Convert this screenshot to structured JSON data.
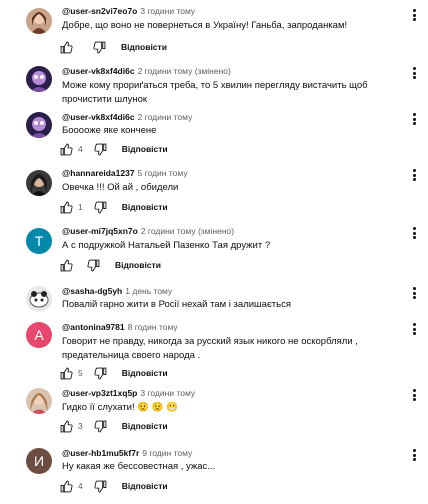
{
  "comments": [
    {
      "author": "@user-sn2vi7eo7o",
      "meta": "3 години тому",
      "text": "Добре, що воно не повернеться в Україну! Ганьба, запроданкам!",
      "likes": "",
      "reply": "Відповісти",
      "avatar": "photo-avatar"
    },
    {
      "author": "@user-vk8xf4di6c",
      "meta": "2 години тому (змінено)",
      "text": "Може кому прориґаться треба, то 5 хвилин перегляду вистачить щоб прочистити шлунок",
      "likes": "",
      "reply": "Відповісти",
      "avatar": "photo-avatar"
    },
    {
      "author": "@user-vk8xf4di6c",
      "meta": "2 години тому",
      "text": "Бооооже яке кончене",
      "likes": "4",
      "reply": "Відповісти",
      "avatar": "photo-avatar"
    },
    {
      "author": "@hannareida1237",
      "meta": "5 годин тому",
      "text": "Овечка !!! Ой ай , обидели",
      "likes": "1",
      "reply": "Відповісти",
      "avatar": "photo-avatar"
    },
    {
      "author": "@user-mi7jq5xn7o",
      "meta": "2 години тому (змінено)",
      "text": "А с подружкой Натальей Пазенко Тая дружит ?",
      "likes": "",
      "reply": "Відповісти",
      "avatar": "letter-avatar",
      "letter": "T",
      "color": "#0288a8"
    },
    {
      "author": "@sasha-dg5yh",
      "meta": "1 день тому",
      "text": "Повалій гарно жити в Росії нехай там і залишається",
      "likes": "",
      "reply": "Відповісти",
      "avatar": "photo-avatar"
    },
    {
      "author": "@antonina9781",
      "meta": "8 годин тому",
      "text": "Говорит не правду, никогда за русский язык никого не оскорбляли , предательница своего народа .",
      "likes": "5",
      "reply": "Відповісти",
      "avatar": "letter-avatar",
      "letter": "A",
      "color": "#e5486c"
    },
    {
      "author": "@user-vp3zt1xq5p",
      "meta": "3 години тому",
      "text": "Гидко її слухати! 😟 😟 😬",
      "likes": "3",
      "reply": "Відповісти",
      "avatar": "photo-avatar"
    },
    {
      "author": "@user-hb1mu5kf7r",
      "meta": "9 годин тому",
      "text": "Ну какая же бессовестная , ужас...",
      "likes": "4",
      "reply": "Відповісти",
      "avatar": "letter-avatar",
      "letter": "И",
      "color": "#6d4c41"
    }
  ],
  "icons": {
    "like": "thumb-up-icon",
    "dislike": "thumb-down-icon",
    "menu": "more-vert-icon"
  }
}
